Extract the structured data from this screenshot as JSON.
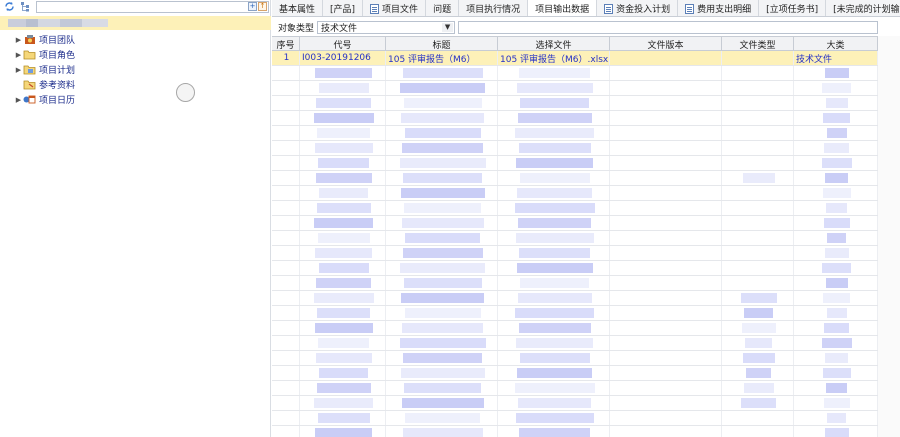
{
  "left": {
    "toolbar": {
      "icons": [
        "refresh-icon",
        "tree-toggle-icon"
      ],
      "search_value": ""
    },
    "tree": {
      "items": [
        {
          "label": "项目团队",
          "icon": "team-icon",
          "expander": "▶"
        },
        {
          "label": "项目角色",
          "icon": "folder-icon",
          "expander": "▶"
        },
        {
          "label": "项目计划",
          "icon": "plan-icon",
          "expander": "▶"
        },
        {
          "label": "参考资料",
          "icon": "reference-icon",
          "expander": ""
        },
        {
          "label": "项目日历",
          "icon": "calendar-icon",
          "expander": "▶"
        }
      ]
    }
  },
  "right": {
    "tabs": [
      {
        "label": "基本属性"
      },
      {
        "label": "[产品]"
      },
      {
        "label": "项目文件",
        "icon": "doc-icon"
      },
      {
        "label": "问题"
      },
      {
        "label": "项目执行情况"
      },
      {
        "label": "项目输出数据",
        "active": true
      },
      {
        "label": "资金投入计划",
        "icon": "doc-icon"
      },
      {
        "label": "费用支出明细",
        "icon": "doc-icon"
      },
      {
        "label": "[立项任务书]"
      },
      {
        "label": "[未完成的计划输"
      }
    ],
    "filter": {
      "label": "对象类型",
      "value": "技术文件",
      "arrow": "▼"
    },
    "grid": {
      "columns": [
        "序号",
        "代号",
        "标题",
        "选择文件",
        "文件版本",
        "文件类型",
        "大类"
      ],
      "selected_row": [
        "1",
        "I003-20191206",
        "105 评审报告（M6）",
        "105 评审报告（M6）.xlsx",
        "",
        "",
        "技术文件"
      ]
    }
  },
  "colors": {
    "selection": "#fdf1b8",
    "link_text": "#2531c7",
    "header_bg": "#f1f2f4"
  }
}
